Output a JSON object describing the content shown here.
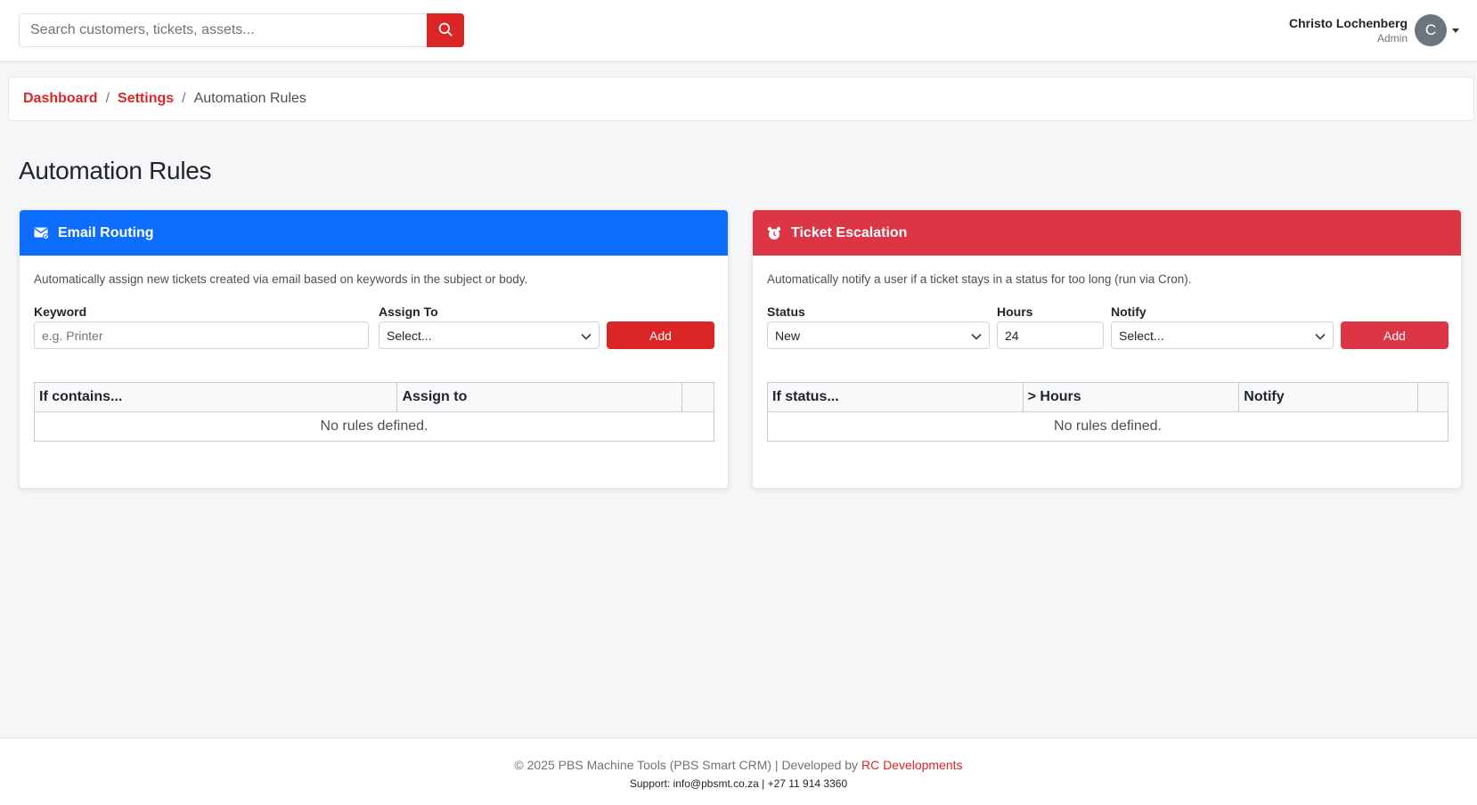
{
  "search": {
    "placeholder": "Search customers, tickets, assets..."
  },
  "user": {
    "name": "Christo Lochenberg",
    "role": "Admin",
    "initial": "C"
  },
  "breadcrumb": {
    "items": [
      "Dashboard",
      "Settings"
    ],
    "current": "Automation Rules",
    "separator": "/"
  },
  "page": {
    "title": "Automation Rules"
  },
  "email_routing": {
    "title": "Email Routing",
    "icon": "envelope-icon",
    "color": "#0d6efd",
    "description": "Automatically assign new tickets created via email based on keywords in the subject or body.",
    "keyword_label": "Keyword",
    "keyword_placeholder": "e.g. Printer",
    "assign_label": "Assign To",
    "assign_value": "Select...",
    "add_label": "Add",
    "columns": [
      "If contains...",
      "Assign to",
      ""
    ],
    "empty_text": "No rules defined."
  },
  "ticket_escalation": {
    "title": "Ticket Escalation",
    "icon": "alarm-clock-icon",
    "color": "#dc3545",
    "description": "Automatically notify a user if a ticket stays in a status for too long (run via Cron).",
    "status_label": "Status",
    "status_value": "New",
    "hours_label": "Hours",
    "hours_value": "24",
    "notify_label": "Notify",
    "notify_value": "Select...",
    "add_label": "Add",
    "columns": [
      "If status...",
      "> Hours",
      "Notify",
      ""
    ],
    "empty_text": "No rules defined."
  },
  "footer": {
    "copyright": "© 2025 PBS Machine Tools (PBS Smart CRM) | Developed by",
    "developer": "RC Developments",
    "support": "Support: info@pbsmt.co.za | +27 11 914 3360"
  },
  "colors": {
    "accent": "#dc2626",
    "primary": "#0d6efd",
    "danger": "#dc3545"
  }
}
